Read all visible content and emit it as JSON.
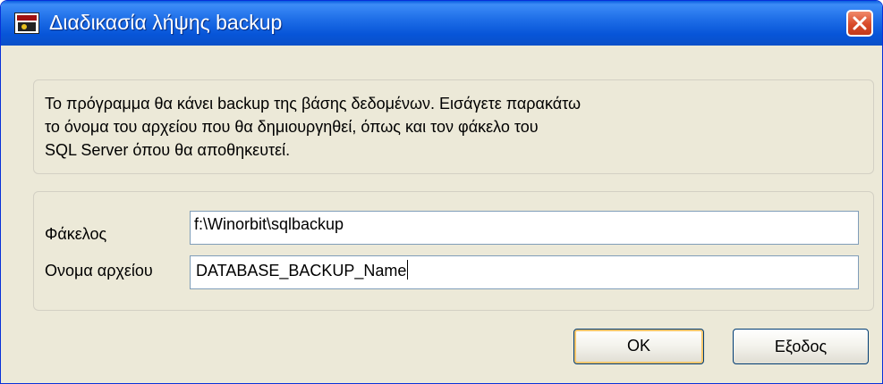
{
  "window": {
    "title": "Διαδικασία λήψης backup"
  },
  "info": {
    "lines": [
      "Το πρόγραμμα θα κάνει backup της βάσης δεδομένων. Εισάγετε παρακάτω",
      "το όνομα του αρχείου που θα δημιουργηθεί, όπως και τον φάκελο του",
      "SQL Server όπου θα αποθηκευτεί."
    ]
  },
  "form": {
    "folder_label": "Φάκελος",
    "folder_value": "f:\\Winorbit\\sqlbackup",
    "filename_label": "Ονομα αρχείου",
    "filename_value": "DATABASE_BACKUP_Name"
  },
  "buttons": {
    "ok_label": "OK",
    "exit_label": "Εξοδος"
  },
  "icons": {
    "app": "app-logo-icon",
    "close": "close-icon"
  },
  "colors": {
    "titlebar": "#0755d8",
    "close_button": "#d84a2a",
    "dialog_background": "#ece9d8"
  }
}
